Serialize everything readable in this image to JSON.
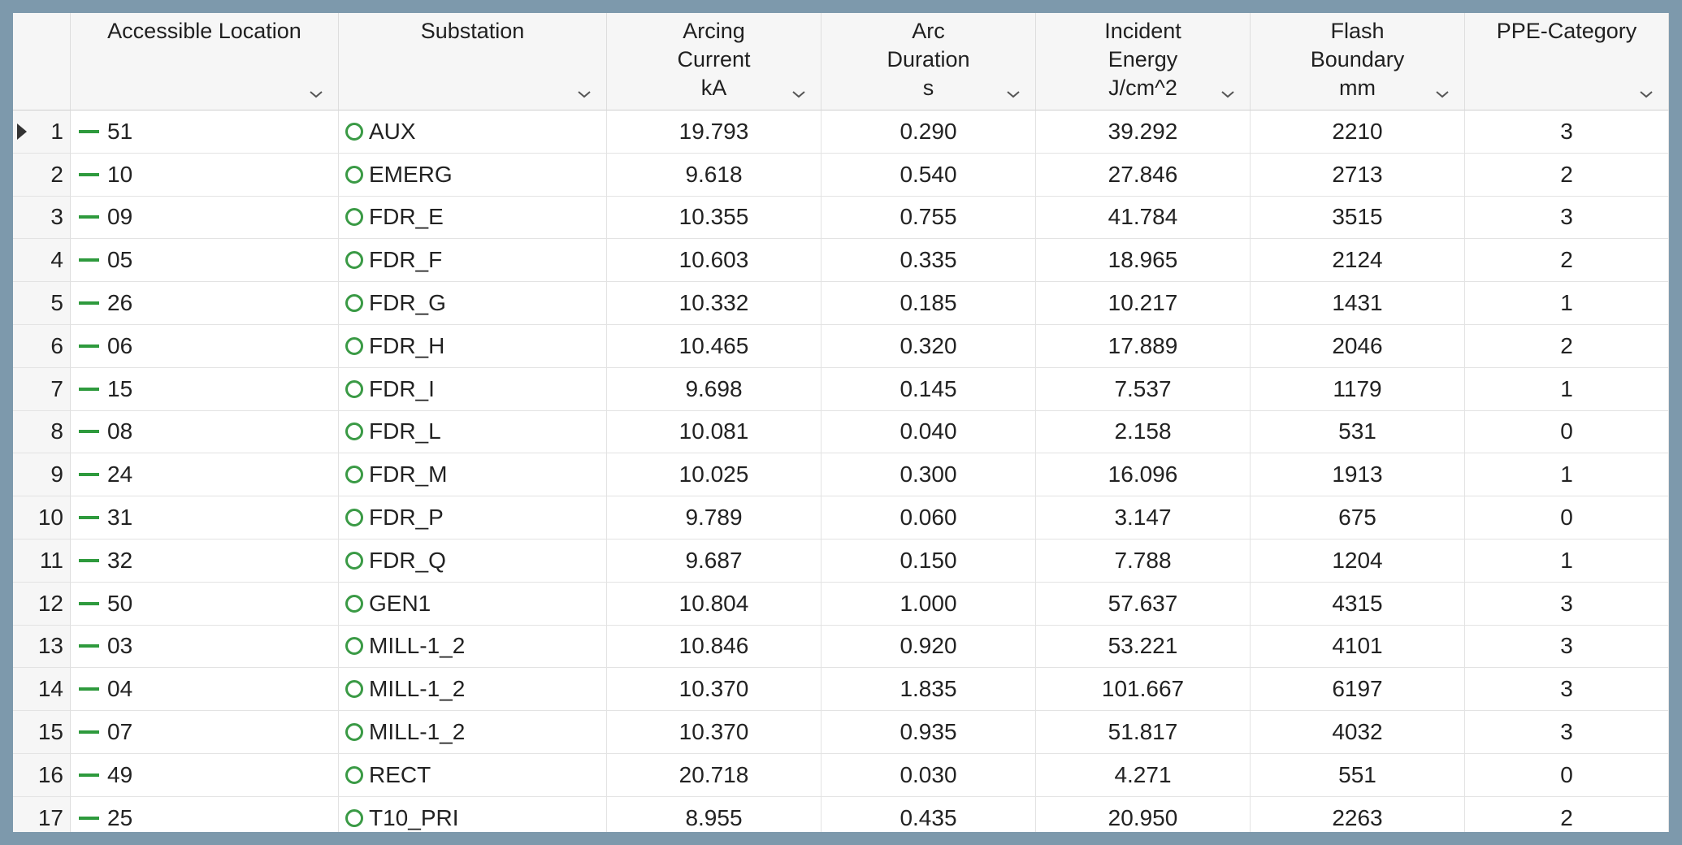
{
  "columns": [
    {
      "label": "Accessible Location"
    },
    {
      "label": "Substation"
    },
    {
      "label": "Arcing\nCurrent\nkA"
    },
    {
      "label": "Arc\nDuration\ns"
    },
    {
      "label": "Incident\nEnergy\nJ/cm^2"
    },
    {
      "label": "Flash\nBoundary\nmm"
    },
    {
      "label": "PPE-Category"
    }
  ],
  "rows": [
    {
      "n": "1",
      "loc": "51",
      "sub": "AUX",
      "arcing_current": "19.793",
      "arc_duration": "0.290",
      "incident_energy": "39.292",
      "flash_boundary": "2210",
      "ppe": "3"
    },
    {
      "n": "2",
      "loc": "10",
      "sub": "EMERG",
      "arcing_current": "9.618",
      "arc_duration": "0.540",
      "incident_energy": "27.846",
      "flash_boundary": "2713",
      "ppe": "2"
    },
    {
      "n": "3",
      "loc": "09",
      "sub": "FDR_E",
      "arcing_current": "10.355",
      "arc_duration": "0.755",
      "incident_energy": "41.784",
      "flash_boundary": "3515",
      "ppe": "3"
    },
    {
      "n": "4",
      "loc": "05",
      "sub": "FDR_F",
      "arcing_current": "10.603",
      "arc_duration": "0.335",
      "incident_energy": "18.965",
      "flash_boundary": "2124",
      "ppe": "2"
    },
    {
      "n": "5",
      "loc": "26",
      "sub": "FDR_G",
      "arcing_current": "10.332",
      "arc_duration": "0.185",
      "incident_energy": "10.217",
      "flash_boundary": "1431",
      "ppe": "1"
    },
    {
      "n": "6",
      "loc": "06",
      "sub": "FDR_H",
      "arcing_current": "10.465",
      "arc_duration": "0.320",
      "incident_energy": "17.889",
      "flash_boundary": "2046",
      "ppe": "2"
    },
    {
      "n": "7",
      "loc": "15",
      "sub": "FDR_I",
      "arcing_current": "9.698",
      "arc_duration": "0.145",
      "incident_energy": "7.537",
      "flash_boundary": "1179",
      "ppe": "1"
    },
    {
      "n": "8",
      "loc": "08",
      "sub": "FDR_L",
      "arcing_current": "10.081",
      "arc_duration": "0.040",
      "incident_energy": "2.158",
      "flash_boundary": "531",
      "ppe": "0"
    },
    {
      "n": "9",
      "loc": "24",
      "sub": "FDR_M",
      "arcing_current": "10.025",
      "arc_duration": "0.300",
      "incident_energy": "16.096",
      "flash_boundary": "1913",
      "ppe": "1"
    },
    {
      "n": "10",
      "loc": "31",
      "sub": "FDR_P",
      "arcing_current": "9.789",
      "arc_duration": "0.060",
      "incident_energy": "3.147",
      "flash_boundary": "675",
      "ppe": "0"
    },
    {
      "n": "11",
      "loc": "32",
      "sub": "FDR_Q",
      "arcing_current": "9.687",
      "arc_duration": "0.150",
      "incident_energy": "7.788",
      "flash_boundary": "1204",
      "ppe": "1"
    },
    {
      "n": "12",
      "loc": "50",
      "sub": "GEN1",
      "arcing_current": "10.804",
      "arc_duration": "1.000",
      "incident_energy": "57.637",
      "flash_boundary": "4315",
      "ppe": "3"
    },
    {
      "n": "13",
      "loc": "03",
      "sub": "MILL-1_2",
      "arcing_current": "10.846",
      "arc_duration": "0.920",
      "incident_energy": "53.221",
      "flash_boundary": "4101",
      "ppe": "3"
    },
    {
      "n": "14",
      "loc": "04",
      "sub": "MILL-1_2",
      "arcing_current": "10.370",
      "arc_duration": "1.835",
      "incident_energy": "101.667",
      "flash_boundary": "6197",
      "ppe": "3"
    },
    {
      "n": "15",
      "loc": "07",
      "sub": "MILL-1_2",
      "arcing_current": "10.370",
      "arc_duration": "0.935",
      "incident_energy": "51.817",
      "flash_boundary": "4032",
      "ppe": "3"
    },
    {
      "n": "16",
      "loc": "49",
      "sub": "RECT",
      "arcing_current": "20.718",
      "arc_duration": "0.030",
      "incident_energy": "4.271",
      "flash_boundary": "551",
      "ppe": "0"
    },
    {
      "n": "17",
      "loc": "25",
      "sub": "T10_PRI",
      "arcing_current": "8.955",
      "arc_duration": "0.435",
      "incident_energy": "20.950",
      "flash_boundary": "2263",
      "ppe": "2"
    }
  ],
  "colors": {
    "background": "#7d99ac",
    "location_line": "#2e9a3d",
    "substation_ring": "#3a9a45"
  },
  "icons": {
    "filter": "chevron-down-icon",
    "current_row": "row-pointer-icon",
    "location": "line-segment-icon",
    "substation": "circle-outline-icon"
  }
}
